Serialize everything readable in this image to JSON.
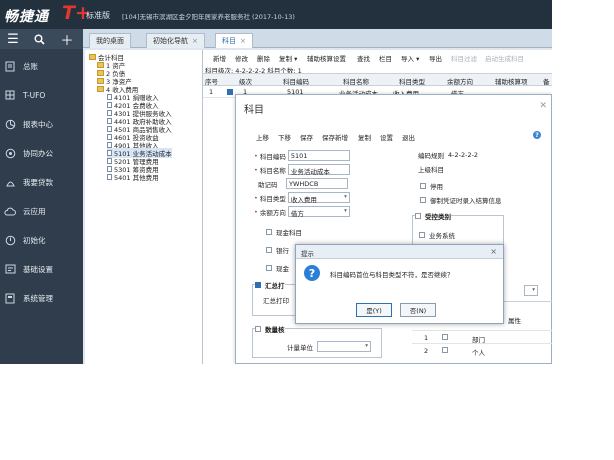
{
  "app": {
    "brand": "畅捷通",
    "brand_t": "T+",
    "edition": "标准版",
    "account": "[104]无锡市滨湖区金夕阳年居家养老服务社  (2017-10-13)"
  },
  "sidebar": {
    "tools": [
      "menu-icon",
      "search-icon",
      "add-icon"
    ],
    "items": [
      {
        "label": "总账",
        "icon": "book-icon"
      },
      {
        "label": "T-UFO",
        "icon": "report-grid-icon"
      },
      {
        "label": "报表中心",
        "icon": "chart-icon"
      },
      {
        "label": "协同办公",
        "icon": "cooperate-icon"
      },
      {
        "label": "我要贷款",
        "icon": "loan-icon"
      },
      {
        "label": "云应用",
        "icon": "cloud-icon"
      },
      {
        "label": "初始化",
        "icon": "init-icon"
      },
      {
        "label": "基础设置",
        "icon": "settings-icon"
      },
      {
        "label": "系统管理",
        "icon": "system-icon"
      }
    ]
  },
  "tabs": [
    {
      "label": "我的桌面",
      "closable": false
    },
    {
      "label": "初始化导航",
      "closable": true
    },
    {
      "label": "科目",
      "closable": true,
      "active": true
    }
  ],
  "tree": {
    "nodes": [
      {
        "label": "会计科目"
      },
      {
        "label": "1 资产"
      },
      {
        "label": "2 负债"
      },
      {
        "label": "3 净资产"
      },
      {
        "label": "4 收入费用"
      },
      {
        "label": "4101 捐赠收入"
      },
      {
        "label": "4201 会费收入"
      },
      {
        "label": "4301 提供服务收入"
      },
      {
        "label": "4401 政府补助收入"
      },
      {
        "label": "4501 商品销售收入"
      },
      {
        "label": "4601 投资收益"
      },
      {
        "label": "4901 其他收入"
      },
      {
        "label": "5101 业务活动成本",
        "selected": true
      },
      {
        "label": "5201 管理费用"
      },
      {
        "label": "5301 筹资费用"
      },
      {
        "label": "5401 其他费用"
      }
    ]
  },
  "main": {
    "toolbar": [
      {
        "label": "新增",
        "enabled": true
      },
      {
        "label": "修改",
        "enabled": true
      },
      {
        "label": "删除",
        "enabled": true
      },
      {
        "label": "复制 ▾",
        "enabled": true
      },
      {
        "label": "辅助核算设置",
        "enabled": true
      },
      {
        "label": "查找",
        "enabled": true
      },
      {
        "label": "栏目",
        "enabled": true
      },
      {
        "label": "导入 ▾",
        "enabled": true
      },
      {
        "label": "导出",
        "enabled": true
      },
      {
        "label": "科目过滤",
        "enabled": false
      },
      {
        "label": "启动生成科目",
        "enabled": false
      }
    ],
    "level_line": "科目级次: 4-2-2-2-2  科目个数: 1",
    "columns": [
      "序号",
      "",
      "级次",
      "科目编码",
      "科目名称",
      "科目类型",
      "余额方向",
      "辅助核算项",
      "备"
    ],
    "row": [
      "1",
      "",
      "1",
      "5101",
      "业务活动成本",
      "收入费用",
      "借方",
      "",
      ""
    ]
  },
  "dialog": {
    "title": "科目",
    "toolbar": [
      "上移",
      "下移",
      "保存",
      "保存新增",
      "复制",
      "设置",
      "退出"
    ],
    "fields": {
      "code_label": "科目编码",
      "code": "5101",
      "name_label": "科目名称",
      "name": "业务活动成本",
      "mnemonic_label": "助记码",
      "mnemonic": "YWHDCB",
      "type_label": "科目类型",
      "type": "收入费用",
      "dir_label": "余额方向",
      "dir": "借方"
    },
    "code_rule_label": "编码规则",
    "code_rule": "4-2-2-2-2",
    "parent_label": "上级科目",
    "disable_label": "停用",
    "ledger_label": "御制凭证时录入结算信息",
    "cash_label": "现金科目",
    "bank_label": "银行",
    "cash_eq_label": "现金",
    "control_group": "受控类别",
    "business_label": "业务系统",
    "summary_group": "汇总打",
    "summary_label": "汇总打印",
    "qty_group": "数量核",
    "unit_label": "计量单位",
    "attr_col": "属性",
    "aux_rows": [
      {
        "n": "1",
        "name": "部门"
      },
      {
        "n": "2",
        "name": "个人"
      }
    ]
  },
  "message": {
    "title": "提示",
    "text": "科目编码首位与科目类型不符，是否继续？",
    "yes": "是(Y)",
    "no": "否(N)"
  }
}
